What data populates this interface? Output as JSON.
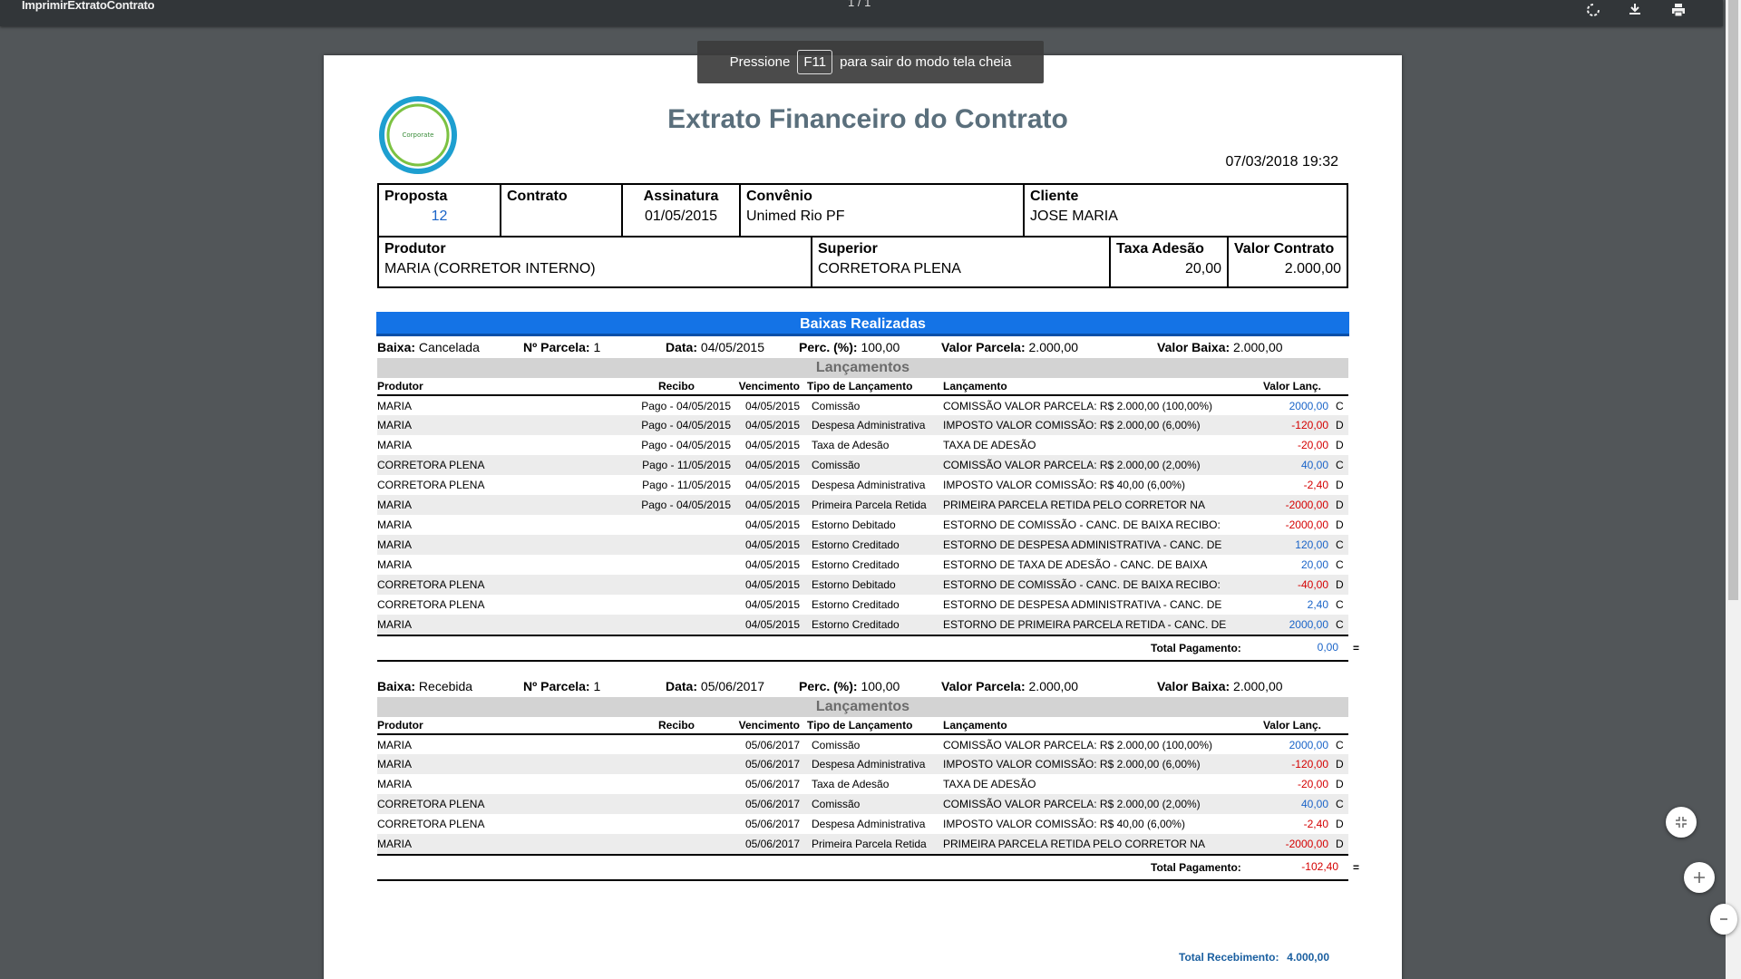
{
  "toolbar": {
    "title": "ImprimirExtratoContrato",
    "page_indicator": "1 / 1",
    "rotate_icon": "rotate-icon",
    "download_icon": "download-icon",
    "print_icon": "print-icon"
  },
  "toast": {
    "prefix": "Pressione",
    "key": "F11",
    "suffix": "para sair do modo tela cheia"
  },
  "document": {
    "logo_text": "Corporate",
    "title": "Extrato Financeiro do Contrato",
    "timestamp": "07/03/2018 19:32",
    "info": {
      "proposta_label": "Proposta",
      "proposta": "12",
      "contrato_label": "Contrato",
      "contrato": "",
      "assinatura_label": "Assinatura",
      "assinatura": "01/05/2015",
      "convenio_label": "Convênio",
      "convenio": "Unimed Rio PF",
      "cliente_label": "Cliente",
      "cliente": "JOSE MARIA",
      "produtor_label": "Produtor",
      "produtor": "MARIA (CORRETOR INTERNO)",
      "superior_label": "Superior",
      "superior": "CORRETORA PLENA",
      "taxa_label": "Taxa Adesão",
      "taxa": "20,00",
      "valor_label": "Valor Contrato",
      "valor": "2.000,00"
    },
    "section_title": "Baixas Realizadas",
    "labels": {
      "baixa": "Baixa:",
      "parcela": "Nº Parcela:",
      "data": "Data:",
      "perc": "Perc. (%):",
      "valor_parcela": "Valor Parcela:",
      "valor_baixa": "Valor Baixa:",
      "lancamentos": "Lançamentos",
      "col_produtor": "Produtor",
      "col_recibo": "Recibo",
      "col_vencimento": "Vencimento",
      "col_tipo": "Tipo de Lançamento",
      "col_lancamento": "Lançamento",
      "col_valor": "Valor Lanç.",
      "total_pagamento": "Total Pagamento:",
      "total_recebimento": "Total Recebimento:"
    },
    "baixas": [
      {
        "status": "Cancelada",
        "parcela": "1",
        "data": "04/05/2015",
        "perc": "100,00",
        "valor_parcela": "2.000,00",
        "valor_baixa": "2.000,00",
        "rows": [
          {
            "produtor": "MARIA",
            "recibo": "Pago - 04/05/2015",
            "venc": "04/05/2015",
            "tipo": "Comissão",
            "lanc": "COMISSÃO VALOR PARCELA: R$ 2.000,00 (100,00%)",
            "valor": "2000,00",
            "dc": "C"
          },
          {
            "produtor": "MARIA",
            "recibo": "Pago - 04/05/2015",
            "venc": "04/05/2015",
            "tipo": "Despesa Administrativa",
            "lanc": "IMPOSTO VALOR COMISSÃO: R$ 2.000,00 (6,00%)",
            "valor": "-120,00",
            "dc": "D"
          },
          {
            "produtor": "MARIA",
            "recibo": "Pago - 04/05/2015",
            "venc": "04/05/2015",
            "tipo": "Taxa de Adesão",
            "lanc": "TAXA DE ADESÃO",
            "valor": "-20,00",
            "dc": "D"
          },
          {
            "produtor": "CORRETORA PLENA",
            "recibo": "Pago - 11/05/2015",
            "venc": "04/05/2015",
            "tipo": "Comissão",
            "lanc": "COMISSÃO VALOR PARCELA: R$ 2.000,00 (2,00%)",
            "valor": "40,00",
            "dc": "C"
          },
          {
            "produtor": "CORRETORA PLENA",
            "recibo": "Pago - 11/05/2015",
            "venc": "04/05/2015",
            "tipo": "Despesa Administrativa",
            "lanc": "IMPOSTO VALOR COMISSÃO: R$ 40,00 (6,00%)",
            "valor": "-2,40",
            "dc": "D"
          },
          {
            "produtor": "MARIA",
            "recibo": "Pago - 04/05/2015",
            "venc": "04/05/2015",
            "tipo": "Primeira Parcela Retida",
            "lanc": "PRIMEIRA PARCELA RETIDA PELO CORRETOR NA",
            "valor": "-2000,00",
            "dc": "D"
          },
          {
            "produtor": "MARIA",
            "recibo": "",
            "venc": "04/05/2015",
            "tipo": "Estorno Debitado",
            "lanc": "ESTORNO DE COMISSÃO - CANC. DE BAIXA RECIBO:",
            "valor": "-2000,00",
            "dc": "D"
          },
          {
            "produtor": "MARIA",
            "recibo": "",
            "venc": "04/05/2015",
            "tipo": "Estorno Creditado",
            "lanc": "ESTORNO DE DESPESA ADMINISTRATIVA - CANC. DE",
            "valor": "120,00",
            "dc": "C"
          },
          {
            "produtor": "MARIA",
            "recibo": "",
            "venc": "04/05/2015",
            "tipo": "Estorno Creditado",
            "lanc": "ESTORNO DE TAXA DE ADESÃO - CANC. DE BAIXA",
            "valor": "20,00",
            "dc": "C"
          },
          {
            "produtor": "CORRETORA PLENA",
            "recibo": "",
            "venc": "04/05/2015",
            "tipo": "Estorno Debitado",
            "lanc": "ESTORNO DE COMISSÃO - CANC. DE BAIXA RECIBO:",
            "valor": "-40,00",
            "dc": "D"
          },
          {
            "produtor": "CORRETORA PLENA",
            "recibo": "",
            "venc": "04/05/2015",
            "tipo": "Estorno Creditado",
            "lanc": "ESTORNO DE DESPESA ADMINISTRATIVA - CANC. DE",
            "valor": "2,40",
            "dc": "C"
          },
          {
            "produtor": "MARIA",
            "recibo": "",
            "venc": "04/05/2015",
            "tipo": "Estorno Creditado",
            "lanc": "ESTORNO DE PRIMEIRA PARCELA RETIDA - CANC. DE",
            "valor": "2000,00",
            "dc": "C"
          }
        ],
        "total": "0,00",
        "total_sign": "="
      },
      {
        "status": "Recebida",
        "parcela": "1",
        "data": "05/06/2017",
        "perc": "100,00",
        "valor_parcela": "2.000,00",
        "valor_baixa": "2.000,00",
        "rows": [
          {
            "produtor": "MARIA",
            "recibo": "",
            "venc": "05/06/2017",
            "tipo": "Comissão",
            "lanc": "COMISSÃO VALOR PARCELA: R$ 2.000,00 (100,00%)",
            "valor": "2000,00",
            "dc": "C"
          },
          {
            "produtor": "MARIA",
            "recibo": "",
            "venc": "05/06/2017",
            "tipo": "Despesa Administrativa",
            "lanc": "IMPOSTO VALOR COMISSÃO: R$ 2.000,00 (6,00%)",
            "valor": "-120,00",
            "dc": "D"
          },
          {
            "produtor": "MARIA",
            "recibo": "",
            "venc": "05/06/2017",
            "tipo": "Taxa de Adesão",
            "lanc": "TAXA DE ADESÃO",
            "valor": "-20,00",
            "dc": "D"
          },
          {
            "produtor": "CORRETORA PLENA",
            "recibo": "",
            "venc": "05/06/2017",
            "tipo": "Comissão",
            "lanc": "COMISSÃO VALOR PARCELA: R$ 2.000,00 (2,00%)",
            "valor": "40,00",
            "dc": "C"
          },
          {
            "produtor": "CORRETORA PLENA",
            "recibo": "",
            "venc": "05/06/2017",
            "tipo": "Despesa Administrativa",
            "lanc": "IMPOSTO VALOR COMISSÃO: R$ 40,00 (6,00%)",
            "valor": "-2,40",
            "dc": "D"
          },
          {
            "produtor": "MARIA",
            "recibo": "",
            "venc": "05/06/2017",
            "tipo": "Primeira Parcela Retida",
            "lanc": "PRIMEIRA PARCELA RETIDA PELO CORRETOR NA",
            "valor": "-2000,00",
            "dc": "D"
          }
        ],
        "total": "-102,40",
        "total_sign": "="
      }
    ],
    "total_recebimento": "4.000,00"
  },
  "zoom": {
    "fit_icon": "fit-page-icon",
    "zoom_in_icon": "zoom-in-icon",
    "zoom_out_icon": "zoom-out-icon"
  }
}
